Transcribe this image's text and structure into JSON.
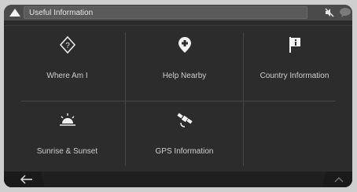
{
  "header": {
    "title": "Useful Information",
    "colors": {
      "bar": "#4a4a4a",
      "field": "#5a5a5a"
    }
  },
  "tiles": [
    {
      "label": "Where Am I",
      "icon": "location-question-icon"
    },
    {
      "label": "Help Nearby",
      "icon": "map-pin-plus-icon"
    },
    {
      "label": "Country Information",
      "icon": "flag-info-icon"
    },
    {
      "label": "Sunrise & Sunset",
      "icon": "sunrise-icon"
    },
    {
      "label": "GPS Information",
      "icon": "satellite-icon"
    }
  ],
  "footer": {
    "back_icon": "back-arrow-icon",
    "up_icon": "chevron-up-icon"
  },
  "colors": {
    "background": "#2b2b2b",
    "text": "#cfcfcf",
    "divider": "#474747"
  }
}
